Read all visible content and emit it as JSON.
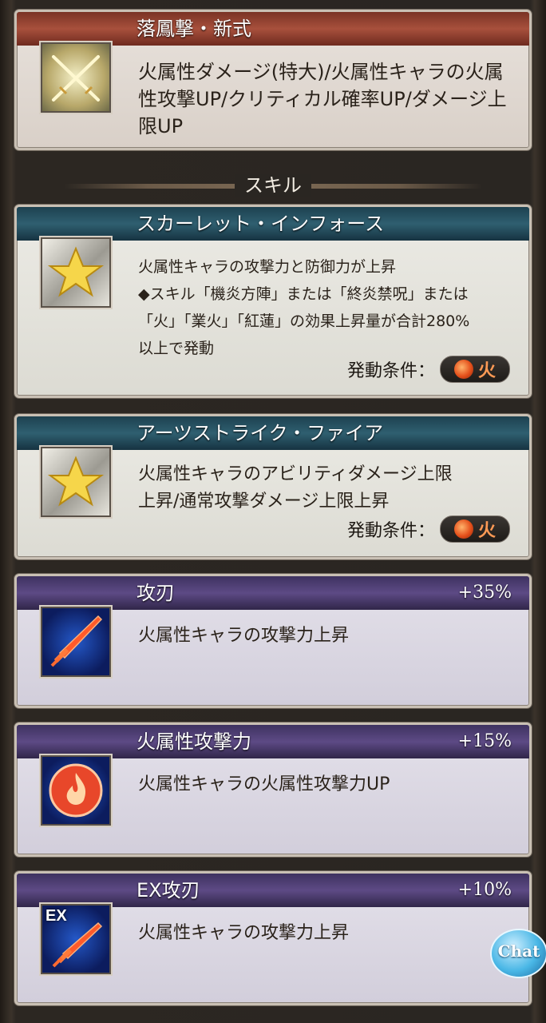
{
  "ougi": {
    "name": "落鳳撃・新式",
    "desc": "火属性ダメージ(特大)/火属性キャラの火属性攻撃UP/クリティカル確率UP/ダメージ上限UP",
    "icon": "crossed-swords-icon"
  },
  "section": {
    "skills_label": "スキル"
  },
  "skills": [
    {
      "name": "スカーレット・インフォース",
      "desc_lines": [
        "火属性キャラの攻撃力と防御力が上昇",
        "◆スキル「機炎方陣」または「終炎禁呪」または",
        "「火」「業火」「紅蓮」の効果上昇量が合計280%",
        "以上で発動"
      ],
      "cond_label": "発動条件：",
      "cond_value": "火",
      "icon": "star-icon"
    },
    {
      "name": "アーツストライク・ファイア",
      "desc_lines": [
        "火属性キャラのアビリティダメージ上限",
        "上昇/通常攻撃ダメージ上限上昇"
      ],
      "cond_label": "発動条件：",
      "cond_value": "火",
      "icon": "star-icon"
    }
  ],
  "weapon_skills": [
    {
      "name": "攻刃",
      "pct": "+35%",
      "desc": "火属性キャラの攻撃力上昇",
      "icon": "fire-sword-icon"
    },
    {
      "name": "火属性攻撃力",
      "pct": "+15%",
      "desc": "火属性キャラの火属性攻撃力UP",
      "icon": "fire-emblem-icon"
    },
    {
      "name": "EX攻刃",
      "pct": "+10%",
      "desc": "火属性キャラの攻撃力上昇",
      "icon": "ex-sword-icon",
      "badge": "EX"
    }
  ],
  "chat_label": "Chat"
}
